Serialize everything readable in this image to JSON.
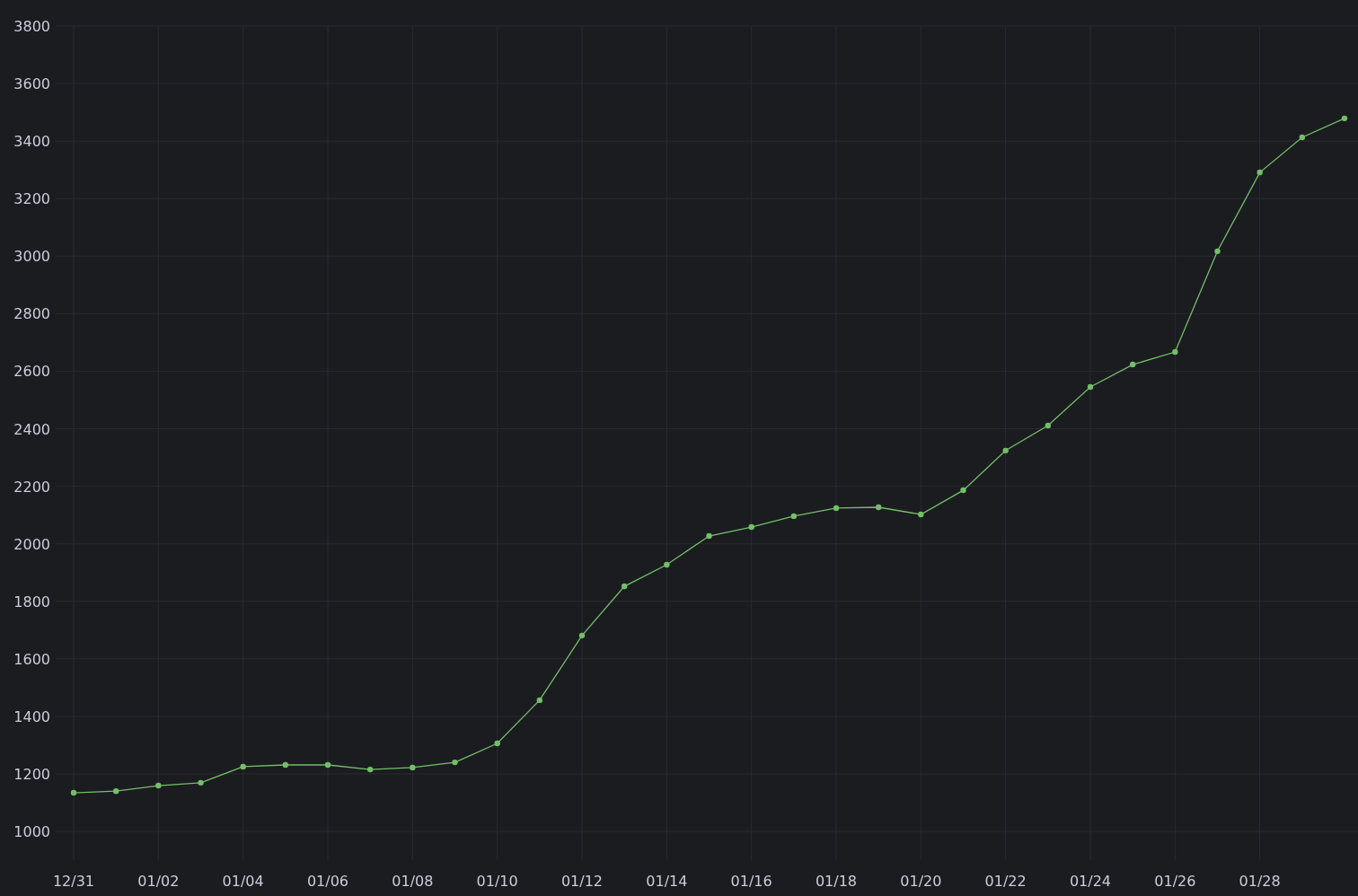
{
  "panel": {
    "chart_data": {
      "type": "line",
      "categories": [
        "12/31",
        null,
        "01/02",
        null,
        "01/04",
        null,
        "01/06",
        null,
        "01/08",
        null,
        "01/10",
        null,
        "01/12",
        null,
        "01/14",
        null,
        "01/16",
        null,
        "01/18",
        null,
        "01/20",
        null,
        "01/22",
        null,
        "01/24",
        null,
        "01/26",
        null,
        "01/28",
        null,
        null
      ],
      "grid": true,
      "series": [
        {
          "color": "#73bf69",
          "marker": true,
          "values": [
            1134,
            1140,
            1159,
            1169,
            1225,
            1231,
            1231,
            1215,
            1222,
            1240,
            1306,
            1456,
            1681,
            1852,
            1927,
            2027,
            2058,
            2096,
            2124,
            2127,
            2102,
            2186,
            2324,
            2411,
            2545,
            2623,
            2667,
            3017,
            3291,
            3413,
            3479
          ]
        }
      ],
      "ylim": [
        1000,
        3800
      ],
      "yticks": [
        1000,
        1200,
        1400,
        1600,
        1800,
        2000,
        2200,
        2400,
        2600,
        2800,
        3000,
        3200,
        3400,
        3600,
        3800
      ]
    }
  }
}
